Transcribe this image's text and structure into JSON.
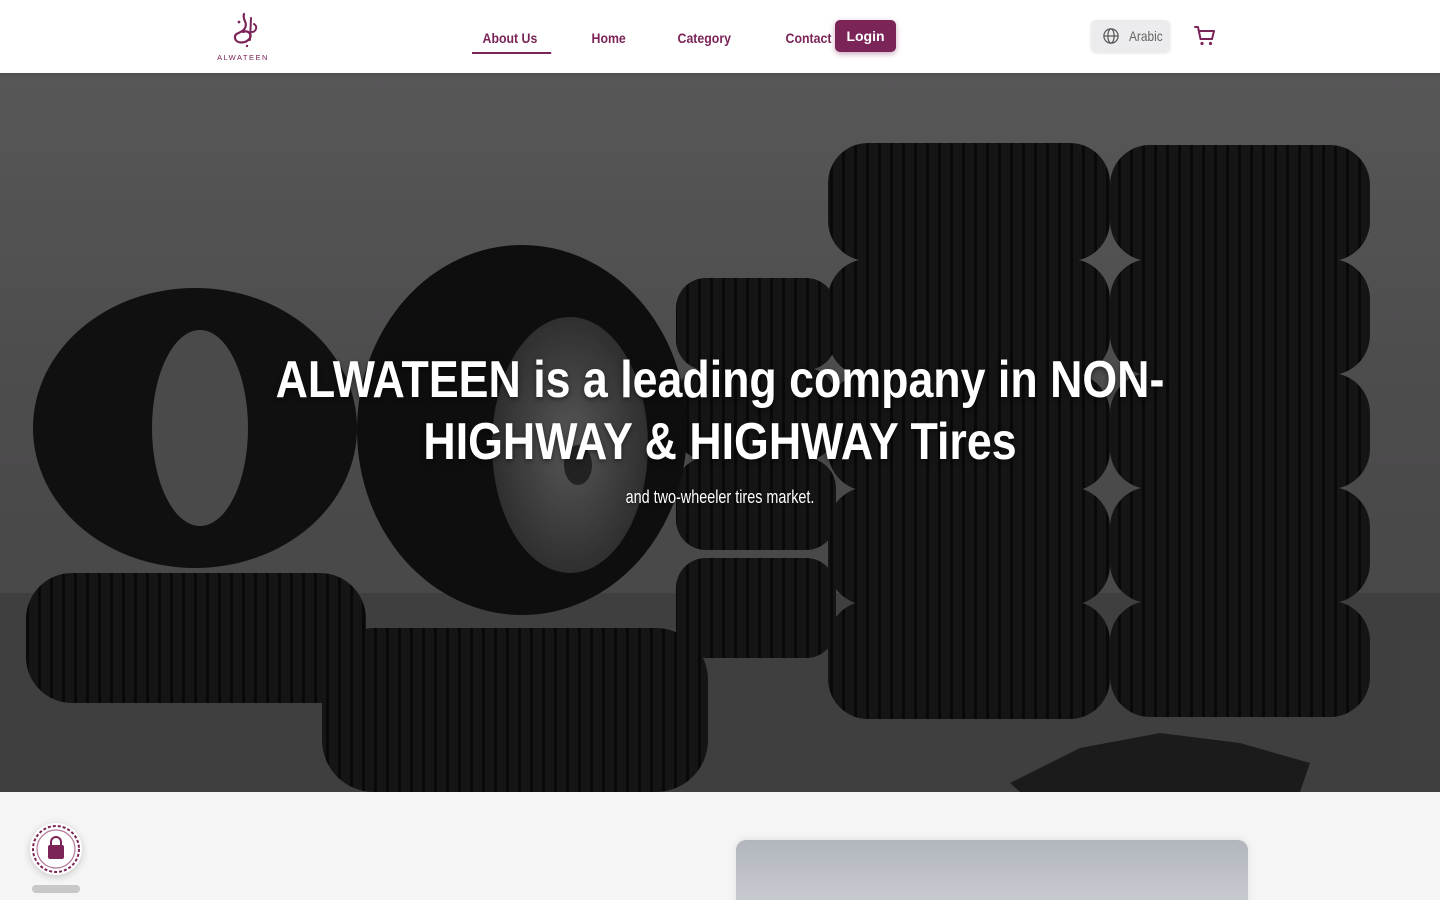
{
  "brand": {
    "name": "ALWATEEN",
    "color": "#7a2457"
  },
  "nav": {
    "links": [
      {
        "label": "About Us",
        "active": true
      },
      {
        "label": "Home",
        "active": false
      },
      {
        "label": "Category",
        "active": false
      },
      {
        "label": "Contact",
        "active": false
      }
    ],
    "login_label": "Login"
  },
  "language": {
    "label": "Arabic",
    "icon": "globe-icon"
  },
  "cart": {
    "icon": "cart-icon"
  },
  "hero": {
    "title": "ALWATEEN is a leading company in NON-HIGHWAY & HIGHWAY Tires",
    "subtitle": "and two-wheeler tires market."
  },
  "floating_button": {
    "icon": "shopping-bag-icon"
  }
}
